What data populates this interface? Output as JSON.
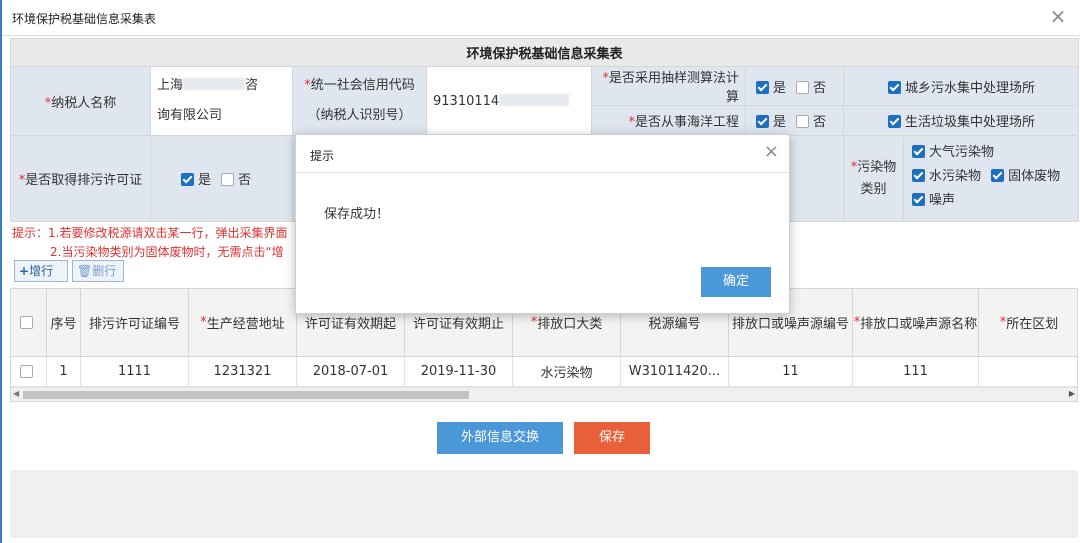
{
  "window": {
    "title": "环境保护税基础信息采集表",
    "close": "×"
  },
  "form": {
    "caption": "环境保护税基础信息采集表",
    "taxpayer_name_label": "纳税人名称",
    "taxpayer_name_value_line1": "上海",
    "taxpayer_name_value_tail": "咨",
    "taxpayer_name_value_line2": "询有限公司",
    "credit_code_label_line1": "统一社会信用代码",
    "credit_code_label_line2": "（纳税人识别号）",
    "credit_code_value": "91310114",
    "sampling_label": "是否采用抽样测算法计算",
    "marine_label": "是否从事海洋工程",
    "yes": "是",
    "no": "否",
    "urban_sewage": "城乡污水集中处理场所",
    "garbage": "生活垃圾集中处理场所",
    "permit_label": "是否取得排污许可证",
    "pollutant_label_line1": "污染物",
    "pollutant_label_line2": "类别",
    "pollutants": {
      "air": "大气污染物",
      "water": "水污染物",
      "solid": "固体废物",
      "noise": "噪声"
    }
  },
  "hints": {
    "line1": "提示：1.若要修改税源请双击某一行，弹出采集界面",
    "line2": "2.当污染物类别为固体废物时，无需点击“增"
  },
  "toolbar": {
    "add": "增行",
    "delete": "删行"
  },
  "grid": {
    "headers": [
      "序号",
      "排污许可证编号",
      "生产经营地址",
      "许可证有效期起",
      "许可证有效期止",
      "排放口大类",
      "税源编号",
      "排放口或噪声源编号",
      "排放口或噪声源名称",
      "所在区划"
    ],
    "rows": [
      [
        "1",
        "1111",
        "1231321",
        "2018-07-01",
        "2019-11-30",
        "水污染物",
        "W31011420...",
        "11",
        "111",
        ""
      ]
    ]
  },
  "buttons": {
    "external_exchange": "外部信息交换",
    "save": "保存"
  },
  "dialog": {
    "title": "提示",
    "message": "保存成功！",
    "ok": "确定",
    "close": "×"
  }
}
